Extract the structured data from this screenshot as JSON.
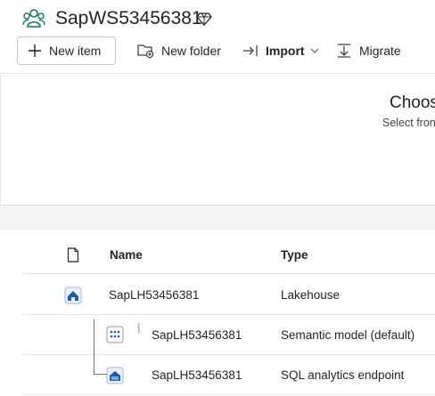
{
  "workspace": {
    "title": "SapWS53456381",
    "icon": "workspace-people-icon",
    "badge_icon": "premium-diamond-icon",
    "accent": "#117865"
  },
  "toolbar": {
    "new_item_label": "New item",
    "new_folder_label": "New folder",
    "import_label": "Import",
    "migrate_label": "Migrate"
  },
  "panel": {
    "title": "Choos",
    "subtitle": "Select fron"
  },
  "table": {
    "columns": {
      "icon": "file-icon",
      "name": "Name",
      "type": "Type"
    },
    "rows": [
      {
        "name": "SapLH53456381",
        "type": "Lakehouse",
        "icon": "lakehouse-icon"
      },
      {
        "name": "SapLH53456381",
        "type": "Semantic model (default)",
        "icon": "semantic-model-icon"
      },
      {
        "name": "SapLH53456381",
        "type": "SQL analytics endpoint",
        "icon": "sql-endpoint-icon"
      }
    ]
  },
  "colors": {
    "item_blue": "#1a5fb4",
    "border": "#e0e0e0",
    "band": "#f5f5f5"
  }
}
